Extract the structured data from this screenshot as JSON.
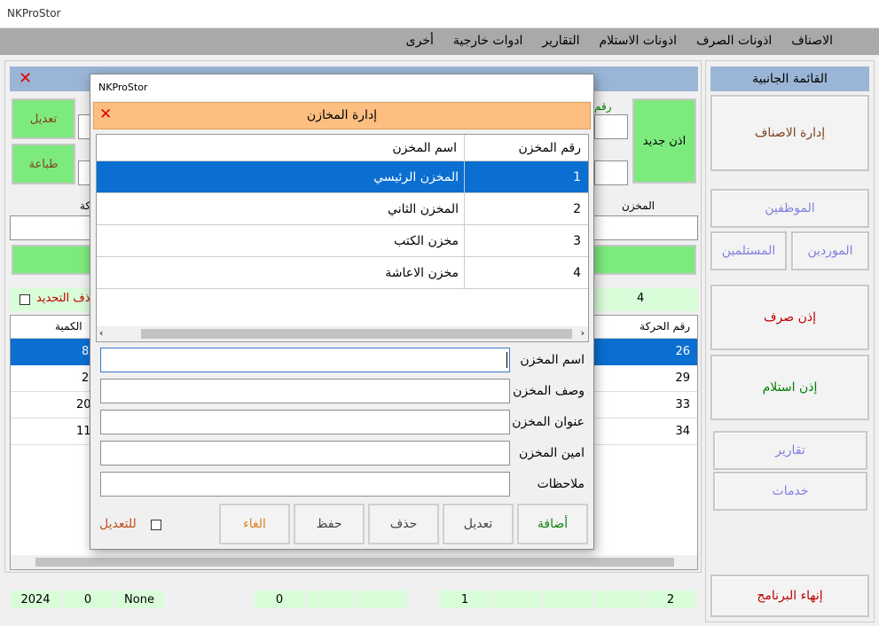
{
  "app": {
    "title": "NKProStor"
  },
  "menu": [
    "الاصناف",
    "اذونات الصرف",
    "اذونات الاستلام",
    "التقارير",
    "ادوات خارجية",
    "أخرى"
  ],
  "sidebar": {
    "header": "القائمة الجانبية",
    "manage_items": "إدارة الاصناف",
    "employees": "الموظفين",
    "suppliers": "الموردين",
    "receivers": "المستلمين",
    "issue_permit": "إذن صرف",
    "receive_permit": "إذن استلام",
    "reports": "تقارير",
    "services": "خدمات",
    "exit": "إنهاء البرنامج",
    "colors": {
      "issue": "#c00000",
      "receive": "#008000",
      "lavender": "#8080e0",
      "brown": "#804020"
    }
  },
  "main": {
    "edit_btn": "تعديل",
    "print_btn": "طباعة",
    "new_permit_btn": "اذن جديد",
    "lbl_number_partial": "رقم",
    "lbl_store": "المخزن",
    "lbl_movement_partial": "كة",
    "count_value": "4",
    "delete_selection": "ذف التحديد",
    "table": {
      "col_right": "رقم الحركة",
      "col_left": "الكمية",
      "rows": [
        {
          "id": "26",
          "qty": "8"
        },
        {
          "id": "29",
          "qty": "2"
        },
        {
          "id": "33",
          "qty": "20"
        },
        {
          "id": "34",
          "qty": "11"
        }
      ]
    },
    "footer": {
      "year": "2024",
      "zero_a": "0",
      "none": "None",
      "zero_b": "0",
      "one": "1",
      "two": "2"
    }
  },
  "dialog": {
    "window_title": "NKProStor",
    "header": "إدارة المخازن",
    "grid": {
      "col_number": "رقم المخزن",
      "col_name": "اسم المخزن",
      "rows": [
        {
          "number": "1",
          "name": "المخزن الرئيسي"
        },
        {
          "number": "2",
          "name": "المخزن الثاني"
        },
        {
          "number": "3",
          "name": "مخزن الكتب"
        },
        {
          "number": "4",
          "name": "مخزن الاعاشة"
        }
      ]
    },
    "form": {
      "name_label": "اسم المخزن",
      "desc_label": "وصف المخزن",
      "address_label": "عنوان المخزن",
      "keeper_label": "امين المخزن",
      "notes_label": "ملاحظات"
    },
    "edit_check_label": "للتعديل",
    "buttons": {
      "add": "أضافة",
      "edit": "تعديل",
      "delete": "حذف",
      "save": "حفظ",
      "cancel": "الغاء"
    }
  }
}
